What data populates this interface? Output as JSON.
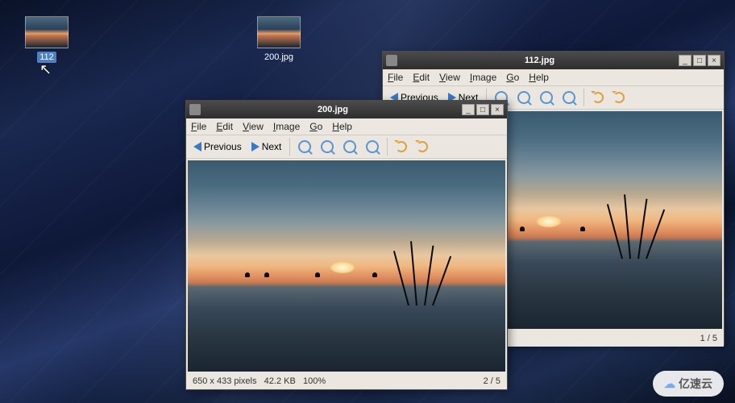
{
  "desktop": {
    "icons": [
      {
        "label": "112",
        "selected": true
      },
      {
        "label": "200.jpg",
        "selected": false
      }
    ]
  },
  "menus": {
    "file": "File",
    "edit": "Edit",
    "view": "View",
    "image": "Image",
    "go": "Go",
    "help": "Help"
  },
  "toolbar": {
    "previous": "Previous",
    "next": "Next"
  },
  "windows": [
    {
      "title": "200.jpg",
      "status": {
        "dimensions": "650 x 433 pixels",
        "filesize": "42.2 KB",
        "zoom": "100%",
        "position": "2 / 5"
      }
    },
    {
      "title": "112.jpg",
      "status": {
        "dimensions": "",
        "filesize": "",
        "zoom": "",
        "position": "1 / 5"
      }
    }
  ],
  "watermark": "亿速云"
}
